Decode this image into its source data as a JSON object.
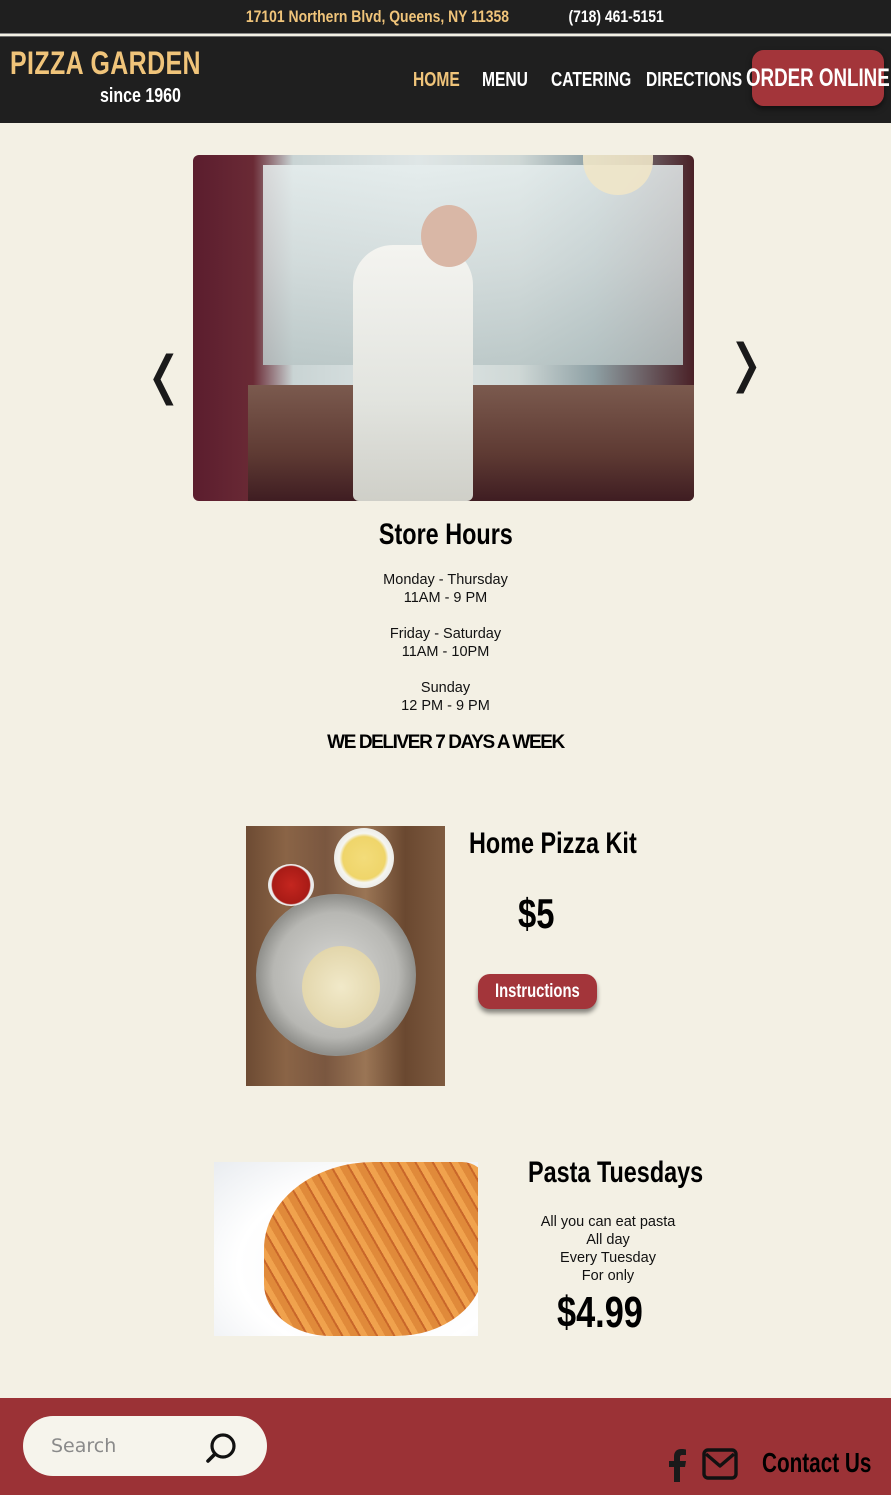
{
  "topbar": {
    "address": "17101 Northern Blvd, Queens, NY 11358",
    "phone": "(718) 461-5151"
  },
  "brand": {
    "name": "PIZZA GARDEN",
    "tagline": "since 1960",
    "colors": {
      "gold": "#f0c47a",
      "red": "#a3353a",
      "dark": "#1f1f1f",
      "cream": "#f3f0e4"
    }
  },
  "nav": {
    "items": [
      {
        "label": "HOME",
        "active": true
      },
      {
        "label": "MENU",
        "active": false
      },
      {
        "label": "CATERING",
        "active": false
      },
      {
        "label": "DIRECTIONS",
        "active": false
      }
    ],
    "order_label": "ORDER ONLINE"
  },
  "carousel": {
    "prev_icon": "chevron-left-icon",
    "next_icon": "chevron-right-icon",
    "prev_glyph": "❬",
    "next_glyph": "❭"
  },
  "hours": {
    "title": "Store Hours",
    "blocks": [
      {
        "days": "Monday - Thursday",
        "time": "11AM - 9 PM"
      },
      {
        "days": "Friday - Saturday",
        "time": "11AM - 10PM"
      },
      {
        "days": "Sunday",
        "time": "12 PM - 9 PM"
      }
    ],
    "delivery": "WE DELIVER 7 DAYS A WEEK"
  },
  "pizza_kit": {
    "title": "Home Pizza Kit",
    "price": "$5",
    "button": "Instructions"
  },
  "pasta": {
    "title": "Pasta Tuesdays",
    "lines": [
      "All you can eat pasta",
      "All day",
      "Every Tuesday",
      "For only"
    ],
    "price": "$4.99"
  },
  "footer": {
    "search_placeholder": "Search",
    "contact": "Contact Us",
    "icons": [
      "search-icon",
      "facebook-icon",
      "mail-icon"
    ]
  }
}
